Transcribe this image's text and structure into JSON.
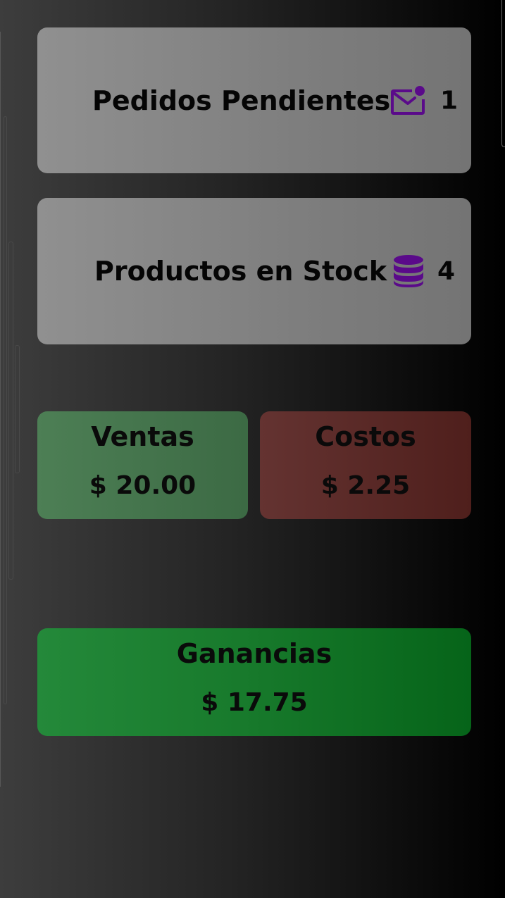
{
  "pedidos": {
    "label": "Pedidos Pendientes",
    "icon": "mail-notification-icon",
    "count": "1"
  },
  "stock": {
    "label": "Productos en Stock",
    "icon": "database-icon",
    "count": "4"
  },
  "ventas": {
    "title": "Ventas",
    "amount": "$ 20.00"
  },
  "costos": {
    "title": "Costos",
    "amount": "$ 2.25"
  },
  "ganancias": {
    "title": "Ganancias",
    "amount": "$ 17.75"
  },
  "colors": {
    "icon_accent": "#5a0a8a",
    "ventas": "#457549",
    "costos": "#5a2a27",
    "ganancias": "#1a7f31"
  }
}
